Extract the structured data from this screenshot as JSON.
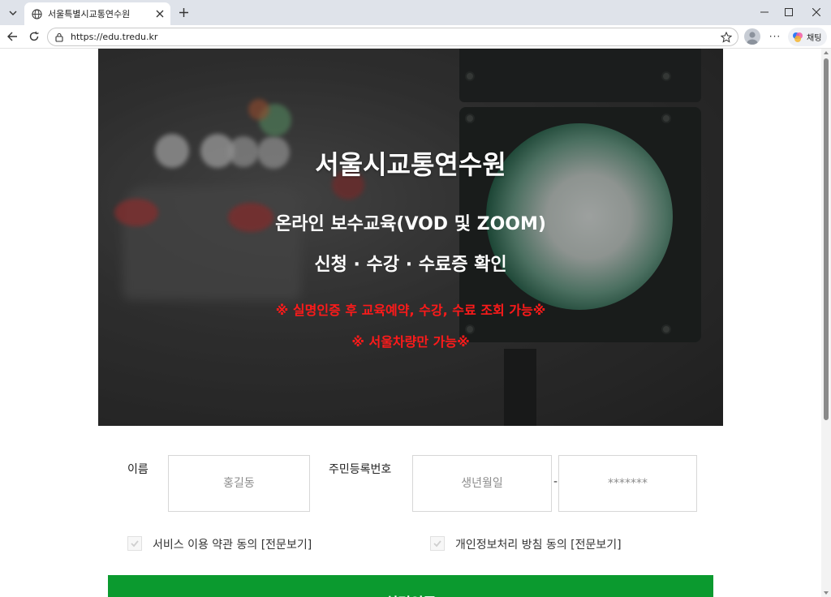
{
  "browser": {
    "tab_title": "서울특별시교통연수원",
    "url": "https://edu.tredu.kr",
    "chat_label": "채팅",
    "more_label": "···"
  },
  "hero": {
    "title": "서울시교통연수원",
    "subtitle_1": "온라인 보수교육(VOD 및 ZOOM)",
    "subtitle_2": "신청 · 수강 · 수료증 확인",
    "notice_1": "※ 실명인증 후 교육예약, 수강, 수료 조회 가능※",
    "notice_2": "※ 서울차량만 가능※",
    "notice_color": "#ff1a1a"
  },
  "form": {
    "name_label": "이름",
    "name_placeholder": "홍길동",
    "rrn_label": "주민등록번호",
    "rrn_front_placeholder": "생년월일",
    "rrn_separator": "-",
    "rrn_back_placeholder": "*******",
    "terms_agree_label": "서비스 이용 약관 동의 [전문보기]",
    "privacy_agree_label": "개인정보처리 방침 동의 [전문보기]",
    "submit_label": "실명인증",
    "submit_color": "#0b9a2f"
  }
}
